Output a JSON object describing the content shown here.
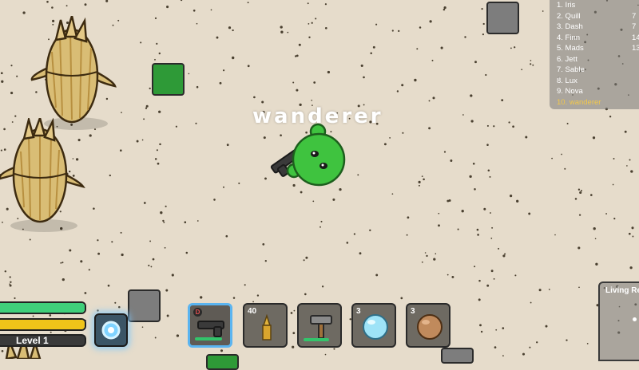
{
  "player": {
    "name": "wanderer"
  },
  "leaderboard": {
    "rows": [
      {
        "name": "1. Iris",
        "score": ""
      },
      {
        "name": "2. Quill",
        "score": "7"
      },
      {
        "name": "3. Dash",
        "score": "7"
      },
      {
        "name": "4. Finn",
        "score": "14"
      },
      {
        "name": "5. Mads",
        "score": "13"
      },
      {
        "name": "6. Jett",
        "score": ""
      },
      {
        "name": "7. Sable",
        "score": ""
      },
      {
        "name": "8. Lux",
        "score": ""
      },
      {
        "name": "9. Nova",
        "score": ""
      },
      {
        "name": "10. wanderer",
        "score": ""
      }
    ]
  },
  "hud": {
    "level_label": "Level 1",
    "health_fraction": 1.0,
    "food_fraction": 1.0,
    "xp_fraction": 0.0,
    "colors": {
      "health": "#3fcf7a",
      "food": "#f0c419",
      "xp": "#3a3a3a",
      "selected_slot": "#5ab4f0"
    }
  },
  "hotbar": {
    "slots": [
      {
        "icon": "pistol-icon",
        "count": "",
        "key": "D",
        "durability_fraction": 0.85
      },
      {
        "icon": "ammo-icon",
        "count": "40",
        "key": "",
        "durability_fraction": null
      },
      {
        "icon": "hammer-icon",
        "count": "",
        "key": "",
        "durability_fraction": 0.8
      },
      {
        "icon": "water-orb-icon",
        "count": "3",
        "key": "",
        "durability_fraction": null
      },
      {
        "icon": "rock-orb-icon",
        "count": "3",
        "key": "",
        "durability_fraction": null
      }
    ]
  },
  "minimap": {
    "title": "Living Re"
  }
}
